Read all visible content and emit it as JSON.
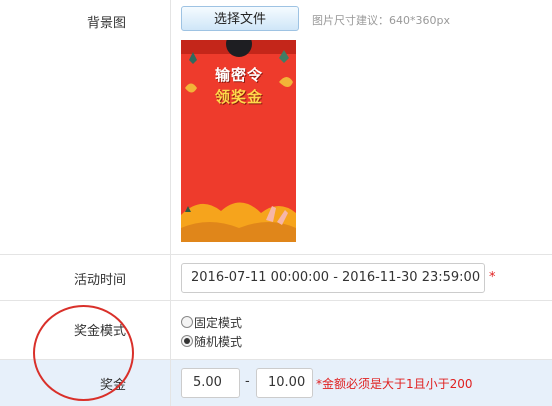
{
  "rows": {
    "background": {
      "label": "背景图",
      "choose_button": "选择文件",
      "size_hint": "图片尺寸建议：640*360px",
      "poster_text_line1": "输密令",
      "poster_text_line2": "领奖金"
    },
    "time": {
      "label": "活动时间",
      "value": "2016-07-11 00:00:00 - 2016-11-30 23:59:00",
      "required_mark": "*"
    },
    "mode": {
      "label": "奖金模式",
      "options": [
        "固定模式",
        "随机模式"
      ],
      "selected": "随机模式"
    },
    "prize": {
      "label": "奖金",
      "min": "5.00",
      "separator": "-",
      "max": "10.00",
      "note": "*金额必须是大于1且小于200"
    }
  },
  "colors": {
    "poster_bg": "#ee3b2c",
    "highlight_row": "#e7f0fa",
    "annotation_circle": "#d9302a",
    "error_text": "#e02020"
  }
}
